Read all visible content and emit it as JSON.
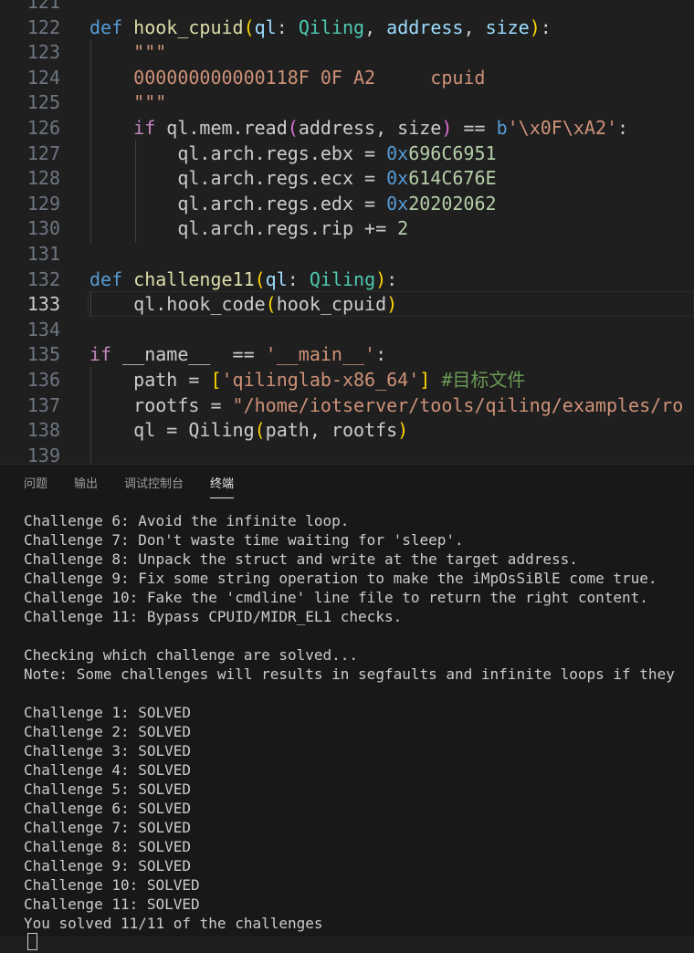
{
  "editor": {
    "lines": [
      {
        "n": "121",
        "segments": []
      },
      {
        "n": "122",
        "segments": [
          {
            "t": "def",
            "c": "kw"
          },
          {
            "t": " ",
            "c": ""
          },
          {
            "t": "hook_cpuid",
            "c": "fn"
          },
          {
            "t": "(",
            "c": "br1"
          },
          {
            "t": "ql",
            "c": "var"
          },
          {
            "t": ": ",
            "c": ""
          },
          {
            "t": "Qiling",
            "c": "cls"
          },
          {
            "t": ", ",
            "c": ""
          },
          {
            "t": "address",
            "c": "var"
          },
          {
            "t": ", ",
            "c": ""
          },
          {
            "t": "size",
            "c": "var"
          },
          {
            "t": ")",
            "c": "br1"
          },
          {
            "t": ":",
            "c": ""
          }
        ]
      },
      {
        "n": "123",
        "segments": [
          {
            "t": "    \"\"\"",
            "c": "str"
          }
        ]
      },
      {
        "n": "124",
        "segments": [
          {
            "t": "    000000000000118F 0F A2     cpuid",
            "c": "str"
          }
        ]
      },
      {
        "n": "125",
        "segments": [
          {
            "t": "    \"\"\"",
            "c": "str"
          }
        ]
      },
      {
        "n": "126",
        "segments": [
          {
            "t": "    ",
            "c": ""
          },
          {
            "t": "if",
            "c": "ctrl"
          },
          {
            "t": " ql.mem.read",
            "c": ""
          },
          {
            "t": "(",
            "c": "br2"
          },
          {
            "t": "address, size",
            "c": ""
          },
          {
            "t": ")",
            "c": "br2"
          },
          {
            "t": " == ",
            "c": ""
          },
          {
            "t": "b",
            "c": "kw"
          },
          {
            "t": "'\\x0F\\xA2'",
            "c": "str"
          },
          {
            "t": ":",
            "c": ""
          }
        ]
      },
      {
        "n": "127",
        "segments": [
          {
            "t": "        ql.arch.regs.ebx = ",
            "c": ""
          },
          {
            "t": "0x",
            "c": "kw"
          },
          {
            "t": "696C6951",
            "c": "num"
          }
        ]
      },
      {
        "n": "128",
        "segments": [
          {
            "t": "        ql.arch.regs.ecx = ",
            "c": ""
          },
          {
            "t": "0x",
            "c": "kw"
          },
          {
            "t": "614C676E",
            "c": "num"
          }
        ]
      },
      {
        "n": "129",
        "segments": [
          {
            "t": "        ql.arch.regs.edx = ",
            "c": ""
          },
          {
            "t": "0x",
            "c": "kw"
          },
          {
            "t": "20202062",
            "c": "num"
          }
        ]
      },
      {
        "n": "130",
        "segments": [
          {
            "t": "        ql.arch.regs.rip += ",
            "c": ""
          },
          {
            "t": "2",
            "c": "num"
          }
        ]
      },
      {
        "n": "131",
        "segments": []
      },
      {
        "n": "132",
        "segments": [
          {
            "t": "def",
            "c": "kw"
          },
          {
            "t": " ",
            "c": ""
          },
          {
            "t": "challenge11",
            "c": "fn"
          },
          {
            "t": "(",
            "c": "br1"
          },
          {
            "t": "ql",
            "c": "var"
          },
          {
            "t": ": ",
            "c": ""
          },
          {
            "t": "Qiling",
            "c": "cls"
          },
          {
            "t": ")",
            "c": "br1"
          },
          {
            "t": ":",
            "c": ""
          }
        ]
      },
      {
        "n": "133",
        "active": true,
        "segments": [
          {
            "t": "    ql.hook_code",
            "c": ""
          },
          {
            "t": "(",
            "c": "br1"
          },
          {
            "t": "hook_cpuid",
            "c": ""
          },
          {
            "t": ")",
            "c": "br1"
          }
        ]
      },
      {
        "n": "134",
        "segments": []
      },
      {
        "n": "135",
        "segments": [
          {
            "t": "if",
            "c": "ctrl"
          },
          {
            "t": " __name__  == ",
            "c": ""
          },
          {
            "t": "'__main__'",
            "c": "str"
          },
          {
            "t": ":",
            "c": ""
          }
        ]
      },
      {
        "n": "136",
        "segments": [
          {
            "t": "    path = ",
            "c": ""
          },
          {
            "t": "[",
            "c": "br1"
          },
          {
            "t": "'qilinglab-x86_64'",
            "c": "str"
          },
          {
            "t": "]",
            "c": "br1"
          },
          {
            "t": " ",
            "c": ""
          },
          {
            "t": "#目标文件",
            "c": "cmt"
          }
        ]
      },
      {
        "n": "137",
        "segments": [
          {
            "t": "    rootfs = ",
            "c": ""
          },
          {
            "t": "\"/home/iotserver/tools/qiling/examples/ro",
            "c": "str"
          }
        ]
      },
      {
        "n": "138",
        "segments": [
          {
            "t": "    ql = Qiling",
            "c": ""
          },
          {
            "t": "(",
            "c": "br1"
          },
          {
            "t": "path, rootfs",
            "c": ""
          },
          {
            "t": ")",
            "c": "br1"
          }
        ]
      },
      {
        "n": "139",
        "segments": []
      }
    ]
  },
  "panel": {
    "tabs": [
      {
        "label": "问题",
        "name": "tab-problems",
        "active": false
      },
      {
        "label": "输出",
        "name": "tab-output",
        "active": false
      },
      {
        "label": "调试控制台",
        "name": "tab-debug-console",
        "active": false
      },
      {
        "label": "终端",
        "name": "tab-terminal",
        "active": true
      }
    ],
    "terminal_lines": [
      "Challenge 6: Avoid the infinite loop.",
      "Challenge 7: Don't waste time waiting for 'sleep'.",
      "Challenge 8: Unpack the struct and write at the target address.",
      "Challenge 9: Fix some string operation to make the iMpOsSiBlE come true.",
      "Challenge 10: Fake the 'cmdline' line file to return the right content.",
      "Challenge 11: Bypass CPUID/MIDR_EL1 checks.",
      "",
      "Checking which challenge are solved...",
      "Note: Some challenges will results in segfaults and infinite loops if they",
      "",
      "Challenge 1: SOLVED",
      "Challenge 2: SOLVED",
      "Challenge 3: SOLVED",
      "Challenge 4: SOLVED",
      "Challenge 5: SOLVED",
      "Challenge 6: SOLVED",
      "Challenge 7: SOLVED",
      "Challenge 8: SOLVED",
      "Challenge 9: SOLVED",
      "Challenge 10: SOLVED",
      "Challenge 11: SOLVED",
      "You solved 11/11 of the challenges"
    ]
  }
}
